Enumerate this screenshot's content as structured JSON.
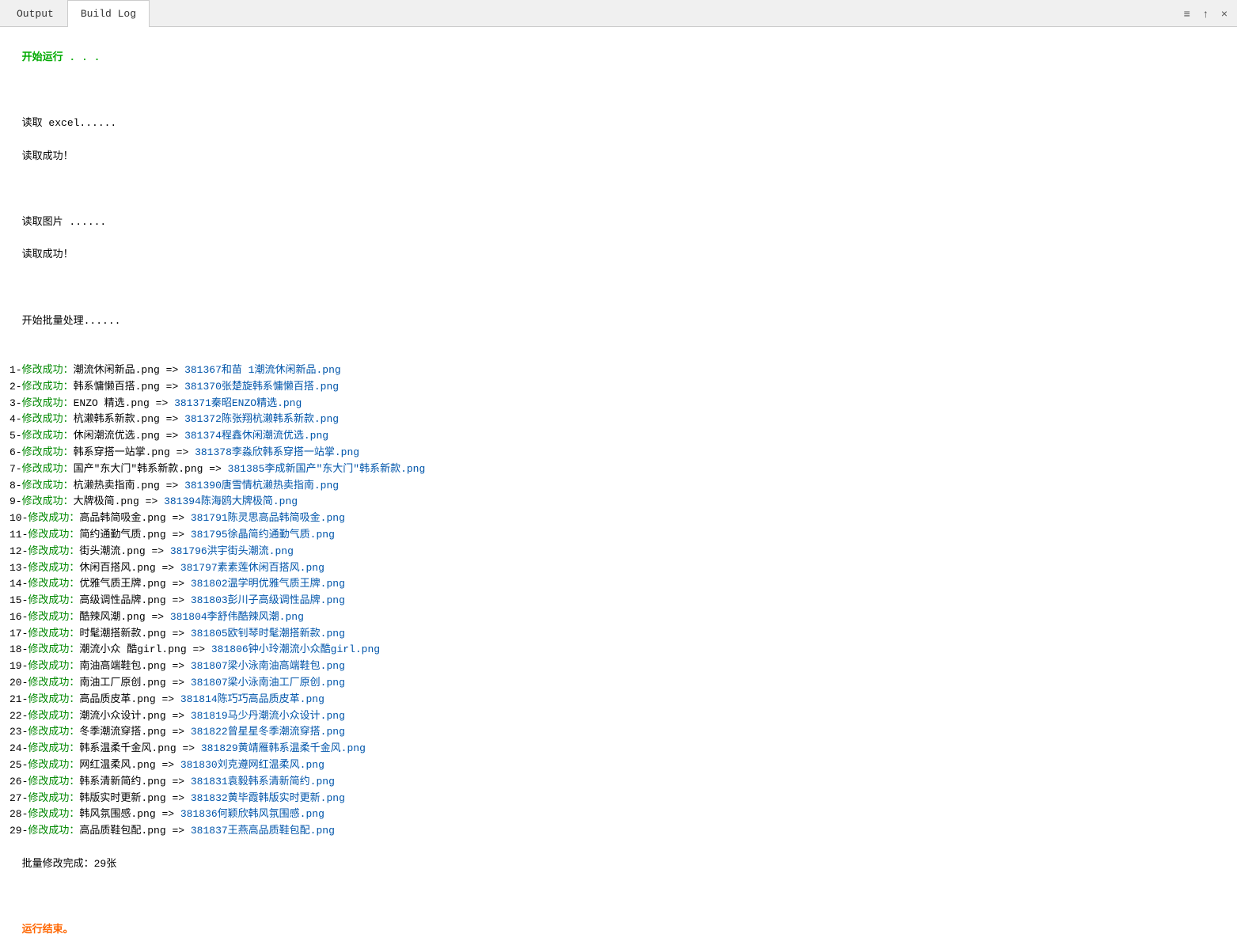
{
  "tabs": [
    {
      "id": "output",
      "label": "Output",
      "active": false
    },
    {
      "id": "buildlog",
      "label": "Build Log",
      "active": true
    }
  ],
  "toolbar": {
    "menu_icon": "≡",
    "up_icon": "↑",
    "close_icon": "×"
  },
  "content": {
    "start_running": "开始运行 . . .",
    "read_excel_label": "读取 excel......",
    "read_excel_success": "读取成功！",
    "read_image_label": "读取图片 ......",
    "read_image_success": "读取成功！",
    "batch_start": "开始批量处理......",
    "items": [
      {
        "index": "1",
        "status": "修改成功：",
        "old": "潮流休闲新品.png",
        "new": "381367和苗 1潮流休闲新品.png"
      },
      {
        "index": "2",
        "status": "修改成功：",
        "old": "韩系慵懒百搭.png",
        "new": "381370张楚旋韩系慵懒百搭.png"
      },
      {
        "index": "3",
        "status": "修改成功：",
        "old": "ENZO 精选.png",
        "new": "381371秦昭ENZO精选.png"
      },
      {
        "index": "4",
        "status": "修改成功：",
        "old": "杭濑韩系新款.png",
        "new": "381372陈张翔杭濑韩系新款.png"
      },
      {
        "index": "5",
        "status": "修改成功：",
        "old": "休闲潮流优选.png",
        "new": "381374程鑫休闲潮流优选.png"
      },
      {
        "index": "6",
        "status": "修改成功：",
        "old": "韩系穿搭一站掌.png",
        "new": "381378李淼欣韩系穿搭一站掌.png"
      },
      {
        "index": "7",
        "status": "修改成功：",
        "old": "国产\"东大门\"韩系新款.png",
        "new": "381385李成新国产\"东大门\"韩系新款.png"
      },
      {
        "index": "8",
        "status": "修改成功：",
        "old": "杭濑热卖指南.png",
        "new": "381390唐雪情杭濑热卖指南.png"
      },
      {
        "index": "9",
        "status": "修改成功：",
        "old": "大牌极简.png",
        "new": "381394陈海鸥大牌极简.png"
      },
      {
        "index": "10",
        "status": "修改成功：",
        "old": "高品韩简吸金.png",
        "new": "381791陈灵思高品韩简吸金.png"
      },
      {
        "index": "11",
        "status": "修改成功：",
        "old": "简约通勤气质.png",
        "new": "381795徐晶简约通勤气质.png"
      },
      {
        "index": "12",
        "status": "修改成功：",
        "old": "街头潮流.png",
        "new": "381796洪宇街头潮流.png"
      },
      {
        "index": "13",
        "status": "修改成功：",
        "old": "休闲百搭风.png",
        "new": "381797素素莲休闲百搭风.png"
      },
      {
        "index": "14",
        "status": "修改成功：",
        "old": "优雅气质王牌.png",
        "new": "381802温学明优雅气质王牌.png"
      },
      {
        "index": "15",
        "status": "修改成功：",
        "old": "高级调性品牌.png",
        "new": "381803彭川子高级调性品牌.png"
      },
      {
        "index": "16",
        "status": "修改成功：",
        "old": "酷辣风潮.png",
        "new": "381804李舒伟酷辣风潮.png"
      },
      {
        "index": "17",
        "status": "修改成功：",
        "old": "时髦潮搭新款.png",
        "new": "381805欧钊琴时髦潮搭新款.png"
      },
      {
        "index": "18",
        "status": "修改成功：",
        "old": "潮流小众 酷girl.png",
        "new": "381806钟小玲潮流小众酷girl.png"
      },
      {
        "index": "19",
        "status": "修改成功：",
        "old": "南油高端鞋包.png",
        "new": "381807梁小泳南油高端鞋包.png"
      },
      {
        "index": "20",
        "status": "修改成功：",
        "old": "南油工厂原创.png",
        "new": "381807梁小泳南油工厂原创.png"
      },
      {
        "index": "21",
        "status": "修改成功：",
        "old": "高品质皮革.png",
        "new": "381814陈巧巧高品质皮革.png"
      },
      {
        "index": "22",
        "status": "修改成功：",
        "old": "潮流小众设计.png",
        "new": "381819马少丹潮流小众设计.png"
      },
      {
        "index": "23",
        "status": "修改成功：",
        "old": "冬季潮流穿搭.png",
        "new": "381822曾星星冬季潮流穿搭.png"
      },
      {
        "index": "24",
        "status": "修改成功：",
        "old": "韩系温柔千金风.png",
        "new": "381829黄靖雁韩系温柔千金风.png"
      },
      {
        "index": "25",
        "status": "修改成功：",
        "old": "网红温柔风.png",
        "new": "381830刘克遵网红温柔风.png"
      },
      {
        "index": "26",
        "status": "修改成功：",
        "old": "韩系清新简约.png",
        "new": "381831袁毅韩系清新简约.png"
      },
      {
        "index": "27",
        "status": "修改成功：",
        "old": "韩版实时更新.png",
        "new": "381832黄毕霞韩版实时更新.png"
      },
      {
        "index": "28",
        "status": "修改成功：",
        "old": "韩风氛围感.png",
        "new": "381836何颖欣韩风氛围感.png"
      },
      {
        "index": "29",
        "status": "修改成功：",
        "old": "高品质鞋包配.png",
        "new": "381837王燕高品质鞋包配.png"
      }
    ],
    "batch_complete": "批量修改完成：29张",
    "end_running": "运行结束。"
  }
}
